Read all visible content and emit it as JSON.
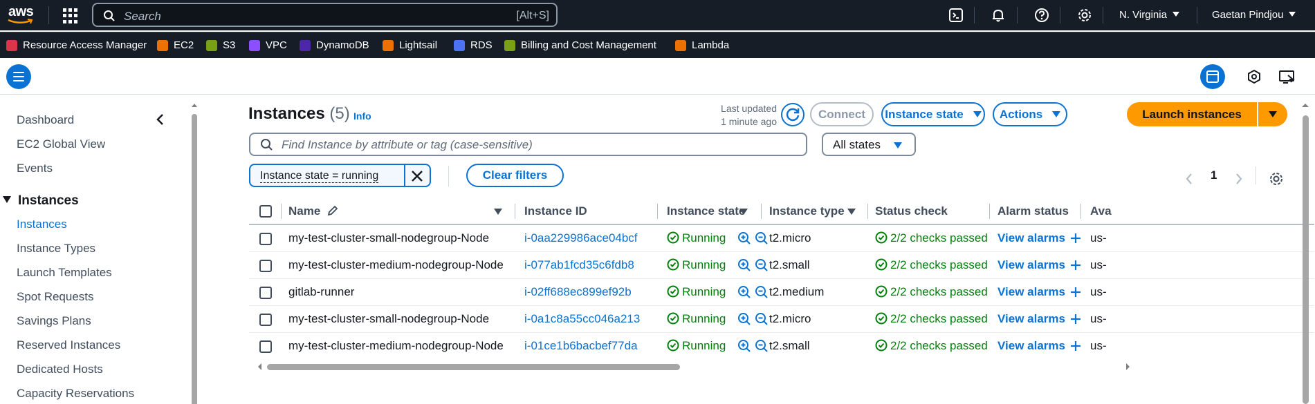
{
  "topnav": {
    "logo": "aws",
    "search_placeholder": "Search",
    "search_shortcut": "[Alt+S]",
    "region": "N. Virginia",
    "user": "Gaetan Pindjou"
  },
  "favorites": [
    {
      "label": "Resource Access Manager",
      "color": "#dd344c"
    },
    {
      "label": "EC2",
      "color": "#ed7100"
    },
    {
      "label": "S3",
      "color": "#7aa116"
    },
    {
      "label": "VPC",
      "color": "#8c4fff"
    },
    {
      "label": "DynamoDB",
      "color": "#4d27aa"
    },
    {
      "label": "Lightsail",
      "color": "#ed7100"
    },
    {
      "label": "RDS",
      "color": "#4d72f3"
    },
    {
      "label": "Billing and Cost Management",
      "color": "#7aa116"
    },
    {
      "label": "Lambda",
      "color": "#ed7100"
    }
  ],
  "sidebar": {
    "top_items": [
      "Dashboard",
      "EC2 Global View",
      "Events"
    ],
    "section": "Instances",
    "items": [
      "Instances",
      "Instance Types",
      "Launch Templates",
      "Spot Requests",
      "Savings Plans",
      "Reserved Instances",
      "Dedicated Hosts",
      "Capacity Reservations"
    ]
  },
  "header": {
    "title": "Instances",
    "count": "(5)",
    "info": "Info",
    "last_updated_line1": "Last updated",
    "last_updated_line2": "1 minute ago",
    "connect": "Connect",
    "instance_state": "Instance state",
    "actions": "Actions",
    "launch": "Launch instances"
  },
  "filters": {
    "placeholder": "Find Instance by attribute or tag (case-sensitive)",
    "states": "All states",
    "token": "Instance state = running",
    "clear": "Clear filters"
  },
  "pagination": {
    "page": "1"
  },
  "table": {
    "columns": [
      "Name",
      "Instance ID",
      "Instance state",
      "Instance type",
      "Status check",
      "Alarm status",
      "Ava"
    ],
    "rows": [
      {
        "name": "my-test-cluster-small-nodegroup-Node",
        "id": "i-0aa229986ace04bcf",
        "state": "Running",
        "type": "t2.micro",
        "check": "2/2 checks passed",
        "alarm": "View alarms",
        "az": "us-"
      },
      {
        "name": "my-test-cluster-medium-nodegroup-Node",
        "id": "i-077ab1fcd35c6fdb8",
        "state": "Running",
        "type": "t2.small",
        "check": "2/2 checks passed",
        "alarm": "View alarms",
        "az": "us-"
      },
      {
        "name": "gitlab-runner",
        "id": "i-02ff688ec899ef92b",
        "state": "Running",
        "type": "t2.medium",
        "check": "2/2 checks passed",
        "alarm": "View alarms",
        "az": "us-"
      },
      {
        "name": "my-test-cluster-small-nodegroup-Node",
        "id": "i-0a1c8a55cc046a213",
        "state": "Running",
        "type": "t2.micro",
        "check": "2/2 checks passed",
        "alarm": "View alarms",
        "az": "us-"
      },
      {
        "name": "my-test-cluster-medium-nodegroup-Node",
        "id": "i-01ce1b6bacbef77da",
        "state": "Running",
        "type": "t2.small",
        "check": "2/2 checks passed",
        "alarm": "View alarms",
        "az": "us-"
      }
    ]
  }
}
